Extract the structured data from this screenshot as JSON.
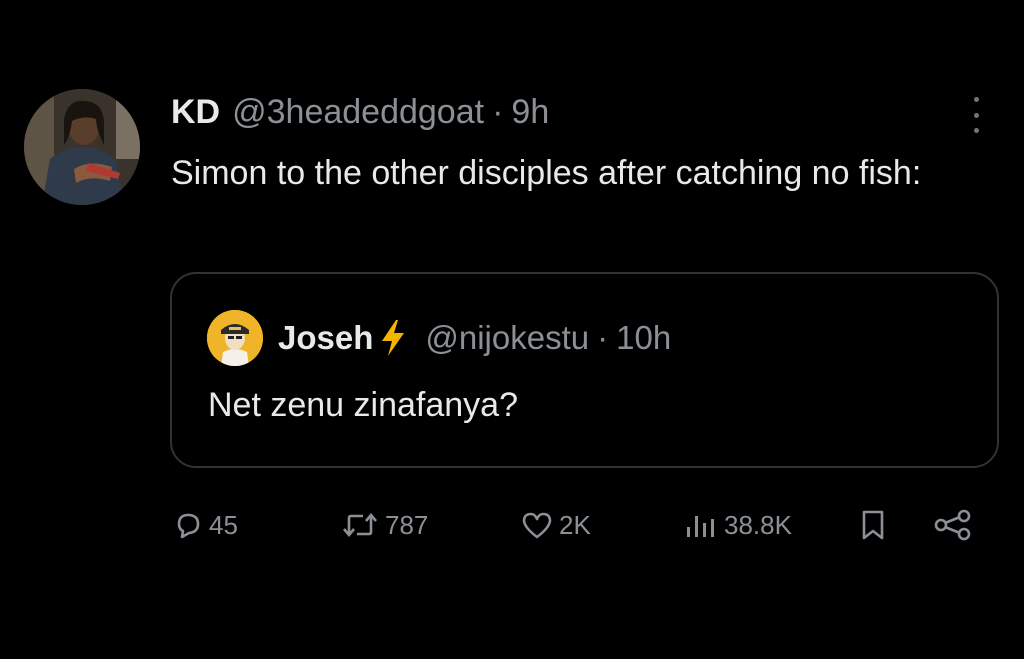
{
  "tweet": {
    "display_name": "KD",
    "handle": "@3headeddgoat",
    "separator": "·",
    "time": "9h",
    "text": "Simon to the other disciples after catching no fish:"
  },
  "quoted_tweet": {
    "display_name": "Joseh",
    "badge_icon": "lightning-bolt-icon",
    "badge_color": "#f5b400",
    "handle": "@nijokestu",
    "separator": "·",
    "time": "10h",
    "text": "Net zenu zinafanya?"
  },
  "actions": {
    "replies": "45",
    "reposts": "787",
    "likes": "2K",
    "views": "38.8K",
    "icons": [
      "reply-icon",
      "repost-icon",
      "like-icon",
      "views-icon",
      "bookmark-icon",
      "share-icon"
    ]
  },
  "colors": {
    "background": "#000000",
    "primary_text": "#e7e9ea",
    "secondary_text": "#8b9096",
    "border": "#2f3336"
  }
}
